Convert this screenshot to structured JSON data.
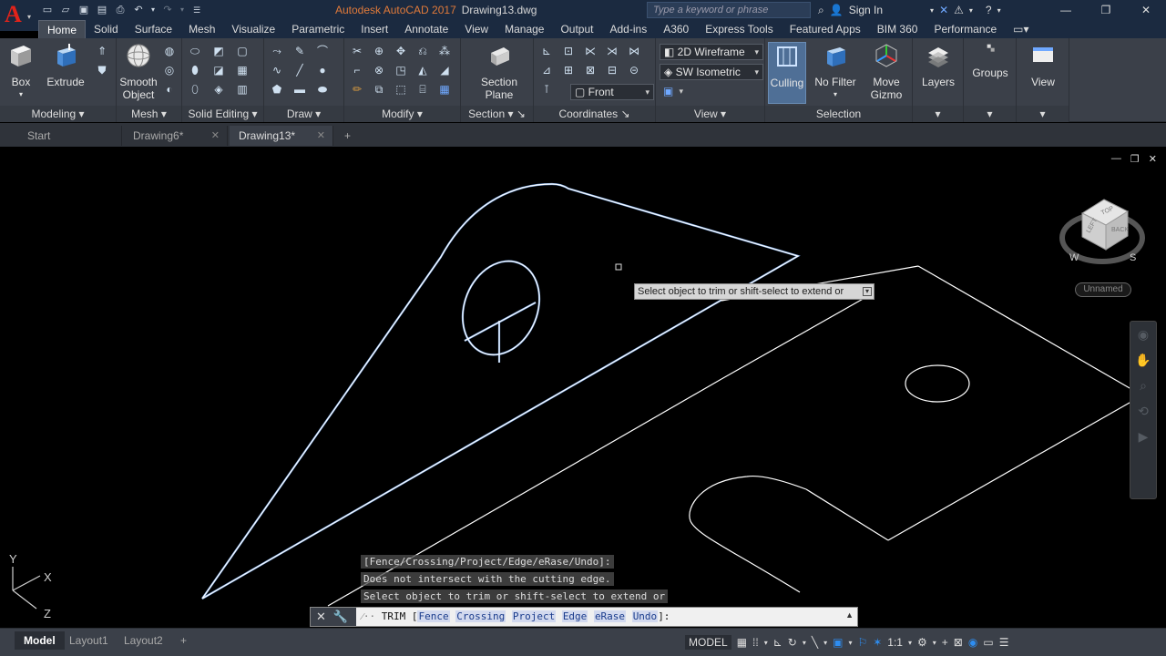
{
  "app": {
    "logo_letter": "A",
    "title": "Autodesk AutoCAD 2017",
    "document": "Drawing13.dwg",
    "search_placeholder": "Type a keyword or phrase",
    "sign_in": "Sign In"
  },
  "ribbon_tabs": [
    "Home",
    "Solid",
    "Surface",
    "Mesh",
    "Visualize",
    "Parametric",
    "Insert",
    "Annotate",
    "View",
    "Manage",
    "Output",
    "Add-ins",
    "A360",
    "Express Tools",
    "Featured Apps",
    "BIM 360",
    "Performance"
  ],
  "ribbon": {
    "box": "Box",
    "extrude": "Extrude",
    "smooth_object_1": "Smooth",
    "smooth_object_2": "Object",
    "section_plane_1": "Section",
    "section_plane_2": "Plane",
    "visual_style": "2D Wireframe",
    "view_preset": "SW Isometric",
    "ucs_view": "Front",
    "culling": "Culling",
    "no_filter": "No Filter",
    "move_gizmo_1": "Move",
    "move_gizmo_2": "Gizmo",
    "layers": "Layers",
    "groups": "Groups",
    "view": "View",
    "panels": {
      "modeling": "Modeling",
      "mesh": "Mesh",
      "solid_editing": "Solid Editing",
      "draw": "Draw",
      "modify": "Modify",
      "section": "Section",
      "coordinates": "Coordinates",
      "view": "View",
      "selection": "Selection"
    }
  },
  "doc_tabs": [
    {
      "label": "Start"
    },
    {
      "label": "Drawing6*"
    },
    {
      "label": "Drawing13*"
    }
  ],
  "viewcube": {
    "top_face": "TOP",
    "left_face": "LEFT",
    "right_face": "BACK",
    "compass_w": "W",
    "compass_s": "S",
    "named_view": "Unnamed"
  },
  "ucs": {
    "y": "Y",
    "x": "X",
    "z": "Z"
  },
  "tooltip": "Select object to trim or shift-select to extend or",
  "command_history": [
    "[Fence/Crossing/Project/Edge/eRase/Undo]:",
    "Does not intersect with the cutting edge.",
    "Select object to trim or shift-select to extend or"
  ],
  "command": {
    "name": "TRIM",
    "open": "[",
    "options": [
      "Fence",
      "Crossing",
      "Project",
      "Edge",
      "eRase",
      "Undo"
    ],
    "close": "]:"
  },
  "layout_tabs": [
    "Model",
    "Layout1",
    "Layout2"
  ],
  "status": {
    "model": "MODEL",
    "scale": "1:1"
  },
  "colors": {
    "selected_outline": "#6f9fe0",
    "geometry": "#ffffff",
    "title_accent": "#e07a3a",
    "logo_red": "#e2231a"
  }
}
